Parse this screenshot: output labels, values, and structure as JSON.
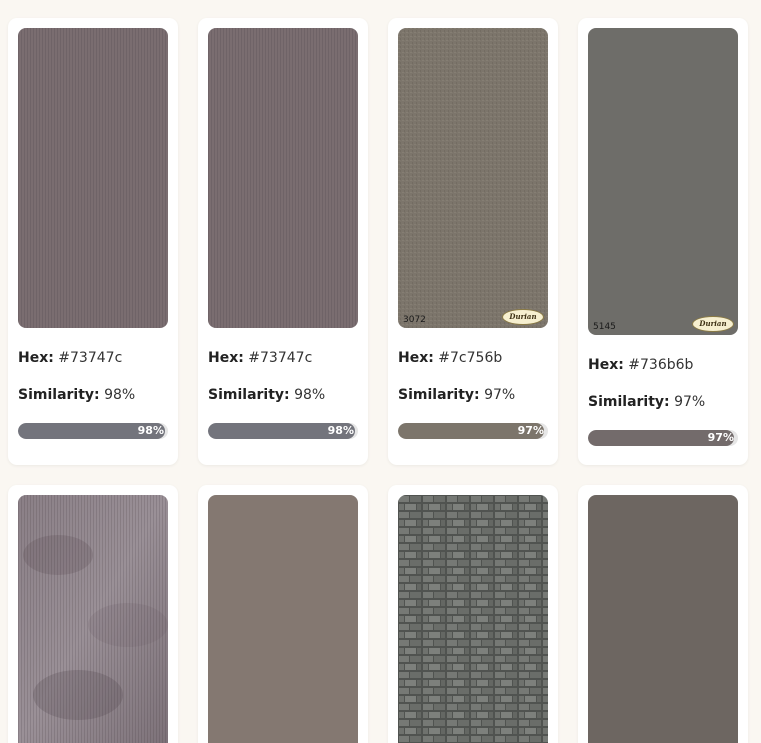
{
  "labels": {
    "hex": "Hex:",
    "similarity": "Similarity:"
  },
  "cards": [
    {
      "swatch_style": "pinstripe",
      "swatch_color": "#73747c",
      "swatch_base": "#7a6d70",
      "swatch_code": "",
      "brand": "",
      "hex": "#73747c",
      "similarity": "98%",
      "similarity_value": 98,
      "bar_label": "98%",
      "bar_color": "#73747c"
    },
    {
      "swatch_style": "pinstripe",
      "swatch_color": "#73747c",
      "swatch_base": "#7a6d70",
      "swatch_code": "",
      "brand": "",
      "hex": "#73747c",
      "similarity": "98%",
      "similarity_value": 98,
      "bar_label": "98%",
      "bar_color": "#73747c"
    },
    {
      "swatch_style": "linen",
      "swatch_color": "#7c756b",
      "swatch_base": "#7c756b",
      "swatch_code": "3072",
      "brand": "Durian",
      "hex": "#7c756b",
      "similarity": "97%",
      "similarity_value": 97,
      "bar_label": "97%",
      "bar_color": "#7c756b"
    },
    {
      "swatch_style": "solid",
      "swatch_color": "#736b6b",
      "swatch_base": "#6e6d69",
      "swatch_code": "5145",
      "brand": "Durian",
      "hex": "#736b6b",
      "similarity": "97%",
      "similarity_value": 97,
      "bar_label": "97%",
      "bar_color": "#736b6b"
    },
    {
      "swatch_style": "marble",
      "swatch_color": "",
      "swatch_base": "#8a7f86",
      "swatch_code": "",
      "brand": "",
      "hex": "",
      "similarity": "",
      "similarity_value": null,
      "bar_label": "",
      "bar_color": ""
    },
    {
      "swatch_style": "solid",
      "swatch_color": "",
      "swatch_base": "#847871",
      "swatch_code": "",
      "brand": "",
      "hex": "",
      "similarity": "",
      "similarity_value": null,
      "bar_label": "",
      "bar_color": ""
    },
    {
      "swatch_style": "stone-brick",
      "swatch_color": "",
      "swatch_base": "#6e706c",
      "swatch_code": "",
      "brand": "",
      "hex": "",
      "similarity": "",
      "similarity_value": null,
      "bar_label": "",
      "bar_color": ""
    },
    {
      "swatch_style": "solid",
      "swatch_color": "",
      "swatch_base": "#6d6661",
      "swatch_code": "",
      "brand": "",
      "hex": "",
      "similarity": "",
      "similarity_value": null,
      "bar_label": "",
      "bar_color": ""
    }
  ]
}
